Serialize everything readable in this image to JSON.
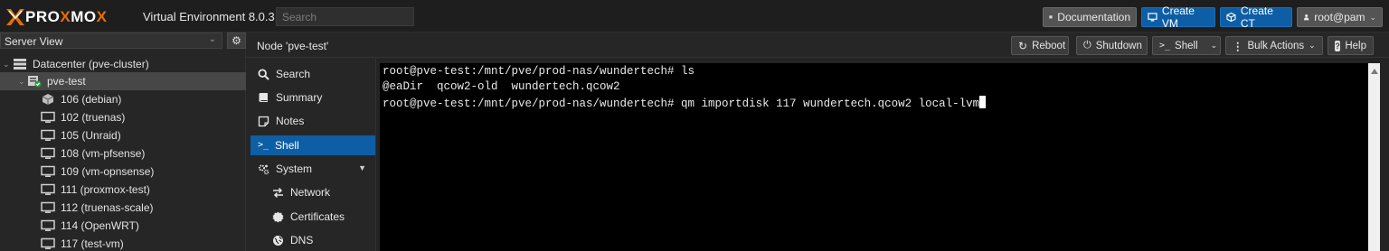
{
  "header": {
    "logo_left": "PRO",
    "logo_x": "X",
    "logo_mid": "MO",
    "logo_x2": "X",
    "product": "Virtual Environment 8.0.3",
    "search_placeholder": "Search",
    "buttons": {
      "documentation": "Documentation",
      "create_vm": "Create VM",
      "create_ct": "Create CT",
      "user": "root@pam"
    }
  },
  "tree": {
    "view": "Server View",
    "datacenter": "Datacenter (pve-cluster)",
    "node": "pve-test",
    "guests": [
      {
        "label": "106 (debian)",
        "icon": "container-icon"
      },
      {
        "label": "102 (truenas)",
        "icon": "monitor-icon"
      },
      {
        "label": "105 (Unraid)",
        "icon": "monitor-icon"
      },
      {
        "label": "108 (vm-pfsense)",
        "icon": "monitor-icon"
      },
      {
        "label": "109 (vm-opnsense)",
        "icon": "monitor-icon"
      },
      {
        "label": "111 (proxmox-test)",
        "icon": "monitor-icon"
      },
      {
        "label": "112 (truenas-scale)",
        "icon": "monitor-icon"
      },
      {
        "label": "114 (OpenWRT)",
        "icon": "monitor-icon"
      },
      {
        "label": "117 (test-vm)",
        "icon": "monitor-icon"
      }
    ]
  },
  "node_header": {
    "title": "Node 'pve-test'",
    "reboot": "Reboot",
    "shutdown": "Shutdown",
    "shell": "Shell",
    "bulk": "Bulk Actions",
    "help": "Help"
  },
  "nav": {
    "items": [
      {
        "label": "Search",
        "icon": "search-icon"
      },
      {
        "label": "Summary",
        "icon": "book-icon"
      },
      {
        "label": "Notes",
        "icon": "note-icon"
      },
      {
        "label": "Shell",
        "icon": "terminal-icon"
      },
      {
        "label": "System",
        "icon": "cogs-icon"
      },
      {
        "label": "Network",
        "icon": "exchange-icon"
      },
      {
        "label": "Certificates",
        "icon": "certificate-icon"
      },
      {
        "label": "DNS",
        "icon": "globe-icon"
      }
    ],
    "active": "Shell"
  },
  "terminal": {
    "lines": [
      "root@pve-test:/mnt/pve/prod-nas/wundertech# ls",
      "@eaDir  qcow2-old  wundertech.qcow2",
      "root@pve-test:/mnt/pve/prod-nas/wundertech# qm importdisk 117 wundertech.qcow2 local-lvm"
    ]
  },
  "colors": {
    "accent_blue": "#0d5ea5",
    "proxmox_orange": "#e57000",
    "background": "#242424",
    "terminal_bg": "#000000"
  }
}
